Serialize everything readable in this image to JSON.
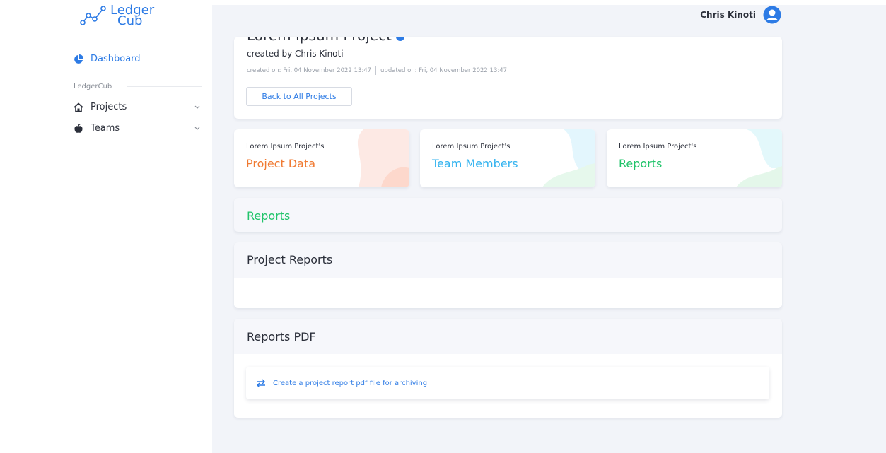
{
  "brand": {
    "name_line1": "Ledger",
    "name_line2": "Cub",
    "accent": "#2d7be5"
  },
  "sidebar": {
    "dashboard": {
      "label": "Dashboard",
      "icon": "pie-chart-icon"
    },
    "section_label": "LedgerCub",
    "items": [
      {
        "label": "Projects",
        "icon": "home-icon"
      },
      {
        "label": "Teams",
        "icon": "apple-icon"
      }
    ]
  },
  "user": {
    "name": "Chris Kinoti",
    "icon": "user-avatar-icon"
  },
  "project": {
    "title": "Lorem Ipsum Project",
    "created_by": "created by Chris Kinoti",
    "created_on": "created on: Fri, 04 November 2022 13:47",
    "updated_on": "updated on: Fri, 04 November 2022 13:47",
    "back_button": "Back to All Projects"
  },
  "tiles": [
    {
      "subtitle": "Lorem Ipsum Project's",
      "title": "Project Data",
      "color": "#f07a32"
    },
    {
      "subtitle": "Lorem Ipsum Project's",
      "title": "Team Members",
      "color": "#33b3ef"
    },
    {
      "subtitle": "Lorem Ipsum Project's",
      "title": "Reports",
      "color": "#22c46b"
    }
  ],
  "sections": {
    "reports_heading": "Reports",
    "project_reports_heading": "Project Reports",
    "reports_pdf_heading": "Reports PDF",
    "pdf_action": "Create a project report pdf file for archiving"
  }
}
